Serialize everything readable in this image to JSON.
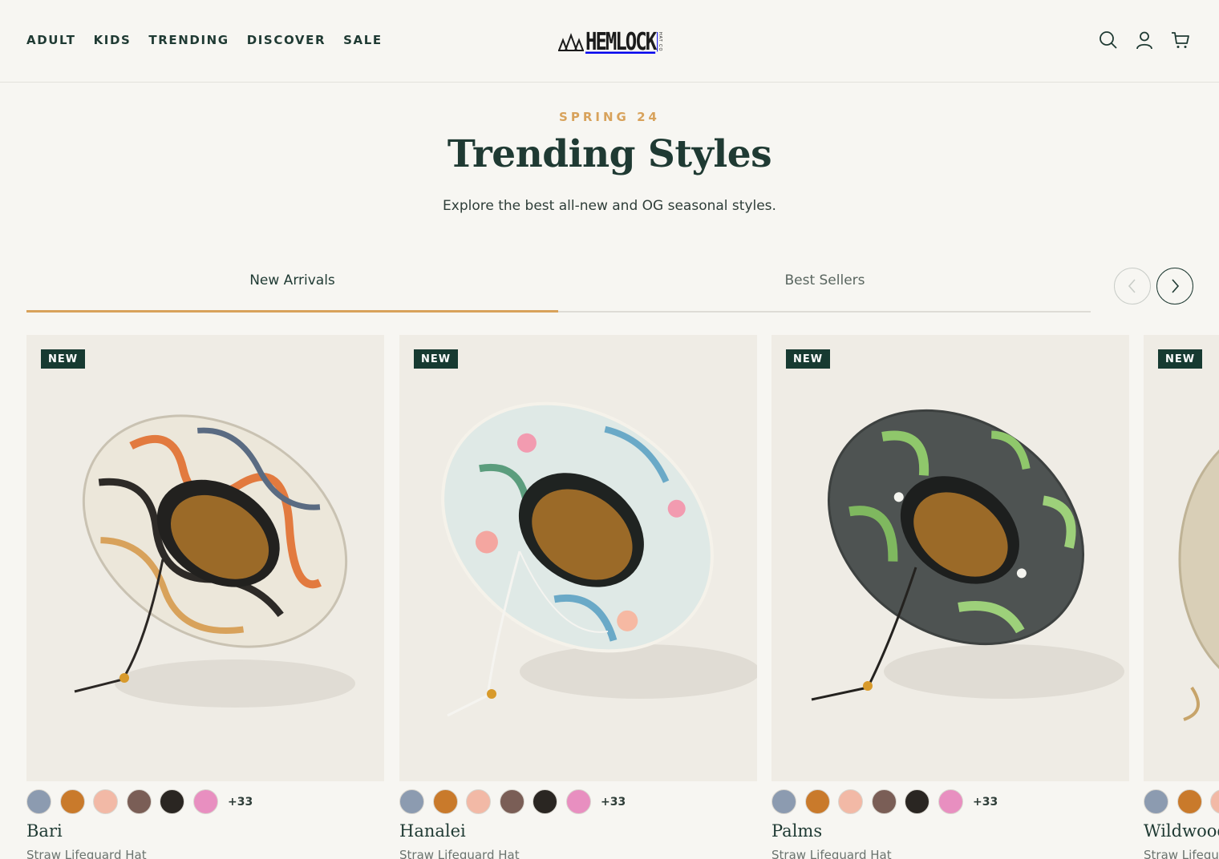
{
  "header": {
    "nav": [
      "ADULT",
      "KIDS",
      "TRENDING",
      "DISCOVER",
      "SALE"
    ],
    "logo_text": "HEMLOCK",
    "logo_sub": "HAT CO",
    "icons": [
      "search-icon",
      "account-icon",
      "cart-icon"
    ]
  },
  "hero": {
    "eyebrow": "SPRING 24",
    "title": "Trending Styles",
    "subtitle": "Explore the best all-new and OG seasonal styles."
  },
  "tabs": {
    "items": [
      "New Arrivals",
      "Best Sellers"
    ],
    "active": "New Arrivals"
  },
  "carousel": {
    "prev_icon": "chevron-left-icon",
    "next_icon": "chevron-right-icon"
  },
  "products": [
    {
      "badge": "NEW",
      "name": "Bari",
      "type": "Straw Lifeguard Hat",
      "more": "+33"
    },
    {
      "badge": "NEW",
      "name": "Hanalei",
      "type": "Straw Lifeguard Hat",
      "more": "+33"
    },
    {
      "badge": "NEW",
      "name": "Palms",
      "type": "Straw Lifeguard Hat",
      "more": "+33"
    },
    {
      "badge": "NEW",
      "name": "Wildwood",
      "type": "Straw Lifeguard Hat",
      "more": ""
    }
  ],
  "swatch_colors": [
    "#8c9bb0",
    "#c97a2b",
    "#f2b9a6",
    "#7a5e56",
    "#2a2622",
    "#e88fc0"
  ],
  "colors": {
    "accent": "#d8a25b",
    "brand_dark": "#173a31",
    "background": "#f7f6f2",
    "image_bg": "#efece5"
  }
}
